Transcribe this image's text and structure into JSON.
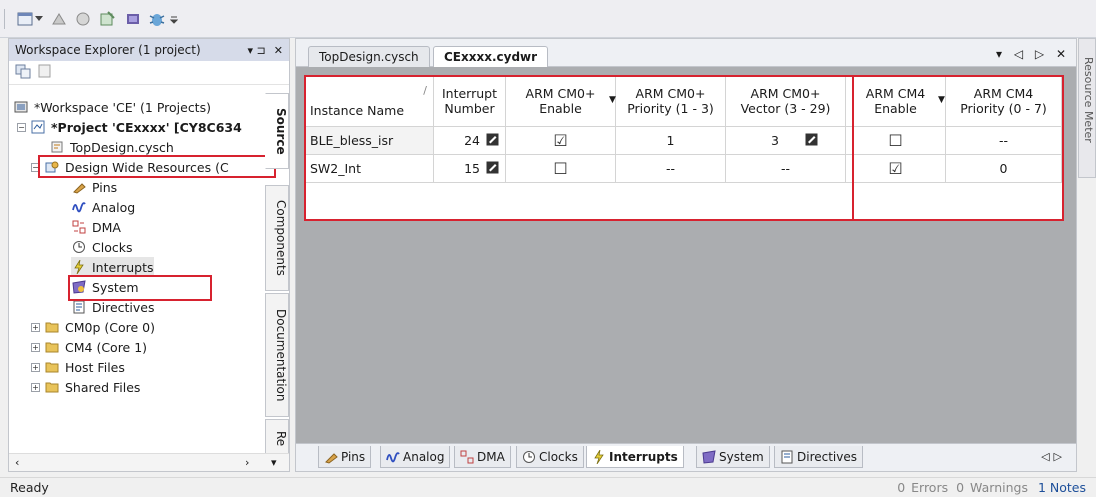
{
  "workspace": {
    "title": "Workspace Explorer (1 project)",
    "pin": "▾ ⊐",
    "close": "✕",
    "tree": [
      {
        "label": "*Workspace 'CE' (1 Projects)",
        "icon": "workspace-icon"
      },
      {
        "label": "*Project 'CExxxx' [CY8C634",
        "icon": "project-icon"
      },
      {
        "label": "TopDesign.cysch",
        "icon": "schematic-icon"
      },
      {
        "label": "Design Wide Resources (C",
        "icon": "dwr-icon"
      },
      {
        "label": "Pins",
        "icon": "pins-icon"
      },
      {
        "label": "Analog",
        "icon": "analog-icon"
      },
      {
        "label": "DMA",
        "icon": "dma-icon"
      },
      {
        "label": "Clocks",
        "icon": "clock-icon"
      },
      {
        "label": "Interrupts",
        "icon": "interrupt-icon"
      },
      {
        "label": "System",
        "icon": "system-icon"
      },
      {
        "label": "Directives",
        "icon": "directives-icon"
      },
      {
        "label": "CM0p (Core 0)",
        "icon": "folder-icon"
      },
      {
        "label": "CM4 (Core 1)",
        "icon": "folder-icon"
      },
      {
        "label": "Host Files",
        "icon": "folder-icon"
      },
      {
        "label": "Shared Files",
        "icon": "folder-icon"
      }
    ],
    "side_tabs": [
      "Source",
      "Components",
      "Documentation",
      "Re"
    ]
  },
  "editor": {
    "tabs": [
      "TopDesign.cysch",
      "CExxxx.cydwr"
    ],
    "tab_controls": "▾ ◁ ▷ ✕",
    "table": {
      "headers": [
        "Instance Name",
        "Interrupt Number",
        "ARM CM0+ Enable",
        "ARM CM0+ Priority (1 - 3)",
        "ARM CM0+ Vector (3 - 29)",
        "ARM CM4 Enable",
        "ARM CM4 Priority (0 - 7)"
      ],
      "rows": [
        {
          "name": "BLE_bless_isr",
          "number": "24",
          "cm0_enable": "☑",
          "cm0_priority": "1",
          "cm0_vector": "3",
          "cm4_enable": "☐",
          "cm4_priority": "--"
        },
        {
          "name": "SW2_Int",
          "number": "15",
          "cm0_enable": "☐",
          "cm0_priority": "--",
          "cm0_vector": "--",
          "cm4_enable": "☑",
          "cm4_priority": "0"
        }
      ]
    },
    "bottom_tabs": [
      "Pins",
      "Analog",
      "DMA",
      "Clocks",
      "Interrupts",
      "System",
      "Directives"
    ]
  },
  "right_panel": "Resource Meter",
  "status": {
    "left": "Ready",
    "errors": "0 Errors",
    "warnings": "0 Warnings",
    "notes": "1 Notes"
  },
  "colors": {
    "highlight": "#d7222f",
    "accent": "#1d4f9a"
  }
}
